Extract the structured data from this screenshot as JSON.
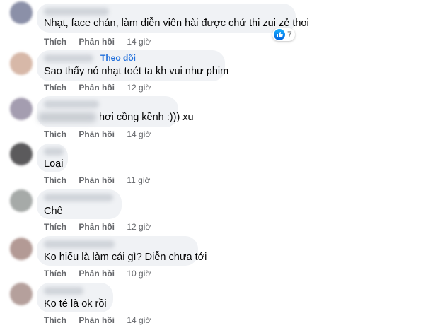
{
  "comments": [
    {
      "text": "Nhạt, face chán, làm diễn viên hài được chứ thi zui zẻ thoi",
      "like": "Thích",
      "reply": "Phản hồi",
      "time": "14 giờ",
      "reaction_count": "7"
    },
    {
      "follow": "Theo dõi",
      "text": "Sao thấy nó nhạt toét ta kh vui như phim",
      "like": "Thích",
      "reply": "Phản hồi",
      "time": "12 giờ"
    },
    {
      "text": "hơi cồng kềnh :))) xu",
      "like": "Thích",
      "reply": "Phản hồi",
      "time": "14 giờ"
    },
    {
      "text": "Loại",
      "like": "Thích",
      "reply": "Phản hồi",
      "time": "11 giờ"
    },
    {
      "text": "Chê",
      "like": "Thích",
      "reply": "Phản hồi",
      "time": "12 giờ"
    },
    {
      "text": "Ko hiểu là làm cái gì? Diễn chưa tới",
      "like": "Thích",
      "reply": "Phản hồi",
      "time": "10 giờ"
    },
    {
      "text": "Ko té là ok rồi",
      "like": "Thích",
      "reply": "Phản hồi",
      "time": "14 giờ"
    }
  ],
  "colors": {
    "bubble": "#f0f2f5",
    "link": "#216fdb",
    "muted": "#65676b",
    "like_blue": "#0866ff"
  },
  "icons": {
    "reaction": "thumbs-up-icon"
  }
}
